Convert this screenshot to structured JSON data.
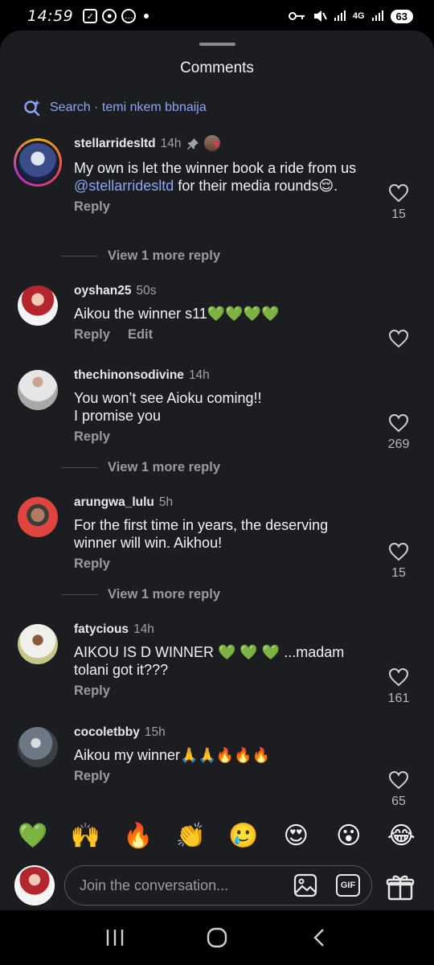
{
  "status_bar": {
    "time": "14:59",
    "network": "4G",
    "battery": "63",
    "icons": [
      "check-box-icon",
      "person-icon",
      "message-bubble-icon",
      "key-icon",
      "mute-icon",
      "signal-icon"
    ]
  },
  "sheet": {
    "title": "Comments"
  },
  "search": {
    "label": "Search · temi nkem bbnaija"
  },
  "comments": [
    {
      "username": "stellarridesltd",
      "time": "14h",
      "text_before": "My own is let the winner book a ride from us ",
      "mention": "@stellarridesltd",
      "text_after": " for their media rounds😌.",
      "reply_label": "Reply",
      "likes": "15",
      "view_more": "View 1 more reply"
    },
    {
      "username": "oyshan25",
      "time": "50s",
      "text": "Aikou the winner s11💚💚💚💚",
      "reply_label": "Reply",
      "edit_label": "Edit",
      "likes": ""
    },
    {
      "username": "thechinonsodivine",
      "time": "14h",
      "text": "You won’t see Aioku coming!!\nI promise you",
      "reply_label": "Reply",
      "likes": "269",
      "view_more": "View 1 more reply"
    },
    {
      "username": "arungwa_lulu",
      "time": "5h",
      "text": "For the first time in years, the deserving winner will win. Aikhou!",
      "reply_label": "Reply",
      "likes": "15",
      "view_more": "View 1 more reply"
    },
    {
      "username": "fatycious",
      "time": "14h",
      "text": "AIKOU IS D WINNER 💚 💚 💚 ...madam tolani got it???",
      "reply_label": "Reply",
      "likes": "161"
    },
    {
      "username": "cocoletbby",
      "time": "15h",
      "text": "Aikou my winner🙏🙏🔥🔥🔥",
      "reply_label": "Reply",
      "likes": "65"
    }
  ],
  "quick_emojis": [
    "💚",
    "🙌",
    "🔥",
    "👏",
    "🥲",
    "😍",
    "😮",
    "😂"
  ],
  "composer": {
    "placeholder": "Join the conversation...",
    "gif_label": "GIF"
  },
  "colors": {
    "sheet_bg": "#1c1d21",
    "accent": "#8ea4f5",
    "muted": "#9a9ba0"
  }
}
